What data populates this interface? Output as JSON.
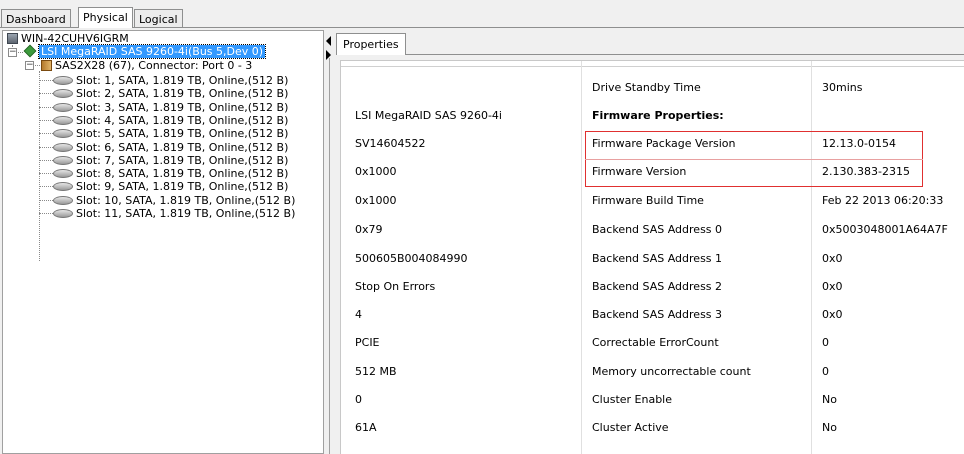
{
  "tabs": [
    "Dashboard",
    "Physical",
    "Logical"
  ],
  "tree": {
    "root": "WIN-42CUHV6IGRM",
    "controller": "LSI MegaRAID SAS 9260-4i(Bus 5,Dev 0)",
    "enclosure": "SAS2X28 (67), Connector: Port 0 - 3",
    "slots": [
      "Slot: 1, SATA, 1.819 TB, Online,(512 B)",
      "Slot: 2, SATA, 1.819 TB, Online,(512 B)",
      "Slot: 3, SATA, 1.819 TB, Online,(512 B)",
      "Slot: 4, SATA, 1.819 TB, Online,(512 B)",
      "Slot: 5, SATA, 1.819 TB, Online,(512 B)",
      "Slot: 6, SATA, 1.819 TB, Online,(512 B)",
      "Slot: 7, SATA, 1.819 TB, Online,(512 B)",
      "Slot: 8, SATA, 1.819 TB, Online,(512 B)",
      "Slot: 9, SATA, 1.819 TB, Online,(512 B)",
      "Slot: 10, SATA, 1.819 TB, Online,(512 B)",
      "Slot: 11, SATA, 1.819 TB, Online,(512 B)"
    ]
  },
  "properties_tab": "Properties",
  "left_values": [
    "",
    "LSI MegaRAID SAS 9260-4i",
    "SV14604522",
    "0x1000",
    "0x1000",
    "0x79",
    "500605B004084990",
    "Stop On Errors",
    "4",
    "PCIE",
    "512 MB",
    "0",
    "61A"
  ],
  "props": [
    {
      "name": "Drive Standby Time",
      "value": "30mins"
    },
    {
      "name": "Firmware Properties:",
      "value": ""
    },
    {
      "name": "Firmware Package Version",
      "value": "12.13.0-0154"
    },
    {
      "name": "Firmware Version",
      "value": "2.130.383-2315"
    },
    {
      "name": "Firmware Build Time",
      "value": "Feb 22 2013  06:20:33"
    },
    {
      "name": "Backend SAS Address 0",
      "value": "0x5003048001A64A7F"
    },
    {
      "name": "Backend SAS Address 1",
      "value": "0x0"
    },
    {
      "name": "Backend SAS Address 2",
      "value": "0x0"
    },
    {
      "name": "Backend SAS Address 3",
      "value": "0x0"
    },
    {
      "name": "Correctable ErrorCount",
      "value": "0"
    },
    {
      "name": "Memory uncorrectable count",
      "value": "0"
    },
    {
      "name": "Cluster Enable",
      "value": "No"
    },
    {
      "name": "Cluster Active",
      "value": "No"
    }
  ],
  "colors": {
    "highlight_box": "#e03030",
    "selection": "#3399ff"
  }
}
